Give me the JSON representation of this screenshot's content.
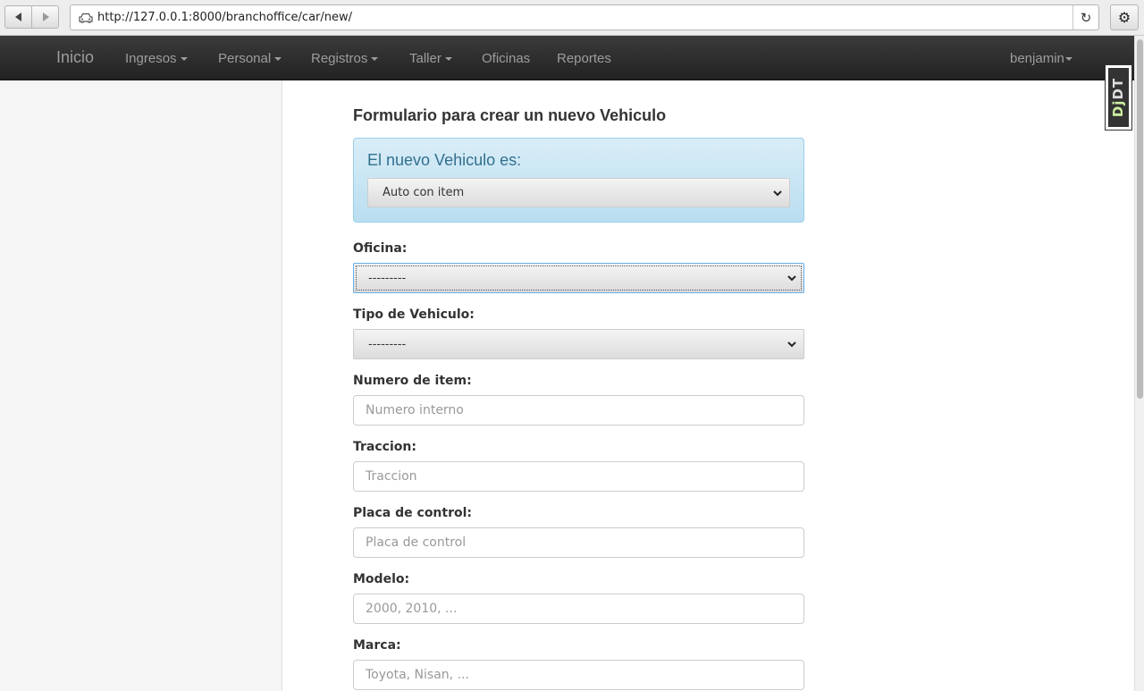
{
  "browser": {
    "url": "http://127.0.0.1:8000/branchoffice/car/new/"
  },
  "navbar": {
    "brand": "Inicio",
    "items": [
      {
        "label": "Ingresos",
        "dropdown": true
      },
      {
        "label": "Personal",
        "dropdown": true
      },
      {
        "label": "Registros",
        "dropdown": true
      },
      {
        "label": "Taller",
        "dropdown": true
      },
      {
        "label": "Oficinas",
        "dropdown": false
      },
      {
        "label": "Reportes",
        "dropdown": false
      }
    ],
    "user": "benjamin"
  },
  "form": {
    "title": "Formulario para crear un nuevo Vehiculo",
    "vehicle_kind": {
      "title": "El nuevo Vehiculo es:",
      "selected": "Auto con item"
    },
    "oficina": {
      "label": "Oficina:",
      "selected": "---------"
    },
    "tipo": {
      "label": "Tipo de Vehiculo:",
      "selected": "---------"
    },
    "numero_item": {
      "label": "Numero de item:",
      "placeholder": "Numero interno"
    },
    "traccion": {
      "label": "Traccion:",
      "placeholder": "Traccion"
    },
    "placa": {
      "label": "Placa de control:",
      "placeholder": "Placa de control"
    },
    "modelo": {
      "label": "Modelo:",
      "placeholder": "2000, 2010, ..."
    },
    "marca": {
      "label": "Marca:",
      "placeholder": "Toyota, Nisan, ..."
    }
  },
  "debug_toolbar": {
    "label_prefix": "Dj",
    "label_suffix": "DT"
  },
  "colors": {
    "navbar": "#222222",
    "alert_bg": "#d9edf7",
    "alert_text": "#31708f",
    "focus_border": "#66afe9"
  }
}
